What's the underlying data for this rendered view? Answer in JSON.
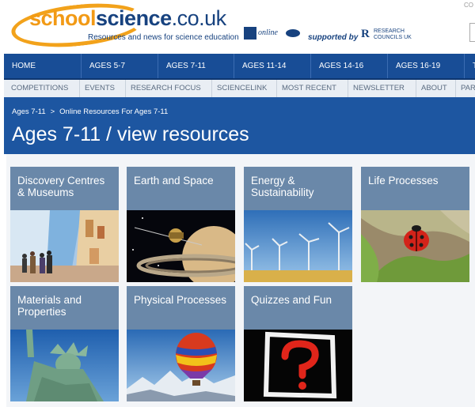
{
  "header": {
    "logo_part1": "school",
    "logo_part2": "science",
    "logo_part3": ".co.uk",
    "tagline": "Resources and news for science education",
    "partner_label": "online",
    "supported_by": "supported by",
    "research_councils_line1": "RESEARCH",
    "research_councils_line2": "COUNCILS UK",
    "corner_text": "CO"
  },
  "nav_primary": [
    "HOME",
    "AGES 5-7",
    "AGES 7-11",
    "AGES 11-14",
    "AGES 14-16",
    "AGES 16-19",
    "T"
  ],
  "nav_secondary": [
    "COMPETITIONS",
    "EVENTS",
    "RESEARCH FOCUS",
    "SCIENCELINK",
    "MOST RECENT",
    "NEWSLETTER",
    "ABOUT",
    "PAR"
  ],
  "breadcrumb": [
    "Ages 7-11",
    ">",
    "Online Resources For Ages 7-11"
  ],
  "page_title": "Ages 7-11 / view resources",
  "tiles": [
    {
      "label": "Discovery Centres & Museums",
      "image": "museum-gallery"
    },
    {
      "label": "Earth and Space",
      "image": "saturn-spacecraft"
    },
    {
      "label": "Energy & Sustainability",
      "image": "wind-turbines"
    },
    {
      "label": "Life Processes",
      "image": "ladybird-on-leaf"
    },
    {
      "label": "Materials and Properties",
      "image": "statue-of-liberty"
    },
    {
      "label": "Physical Processes",
      "image": "hot-air-balloon"
    },
    {
      "label": "Quizzes and Fun",
      "image": "question-mark"
    }
  ],
  "colors": {
    "nav_primary_bg": "#184d96",
    "title_band_bg": "#1d56a1",
    "tile_label_bg": "#6a88a9",
    "logo_orange": "#f29a15",
    "logo_blue": "#17427f"
  }
}
